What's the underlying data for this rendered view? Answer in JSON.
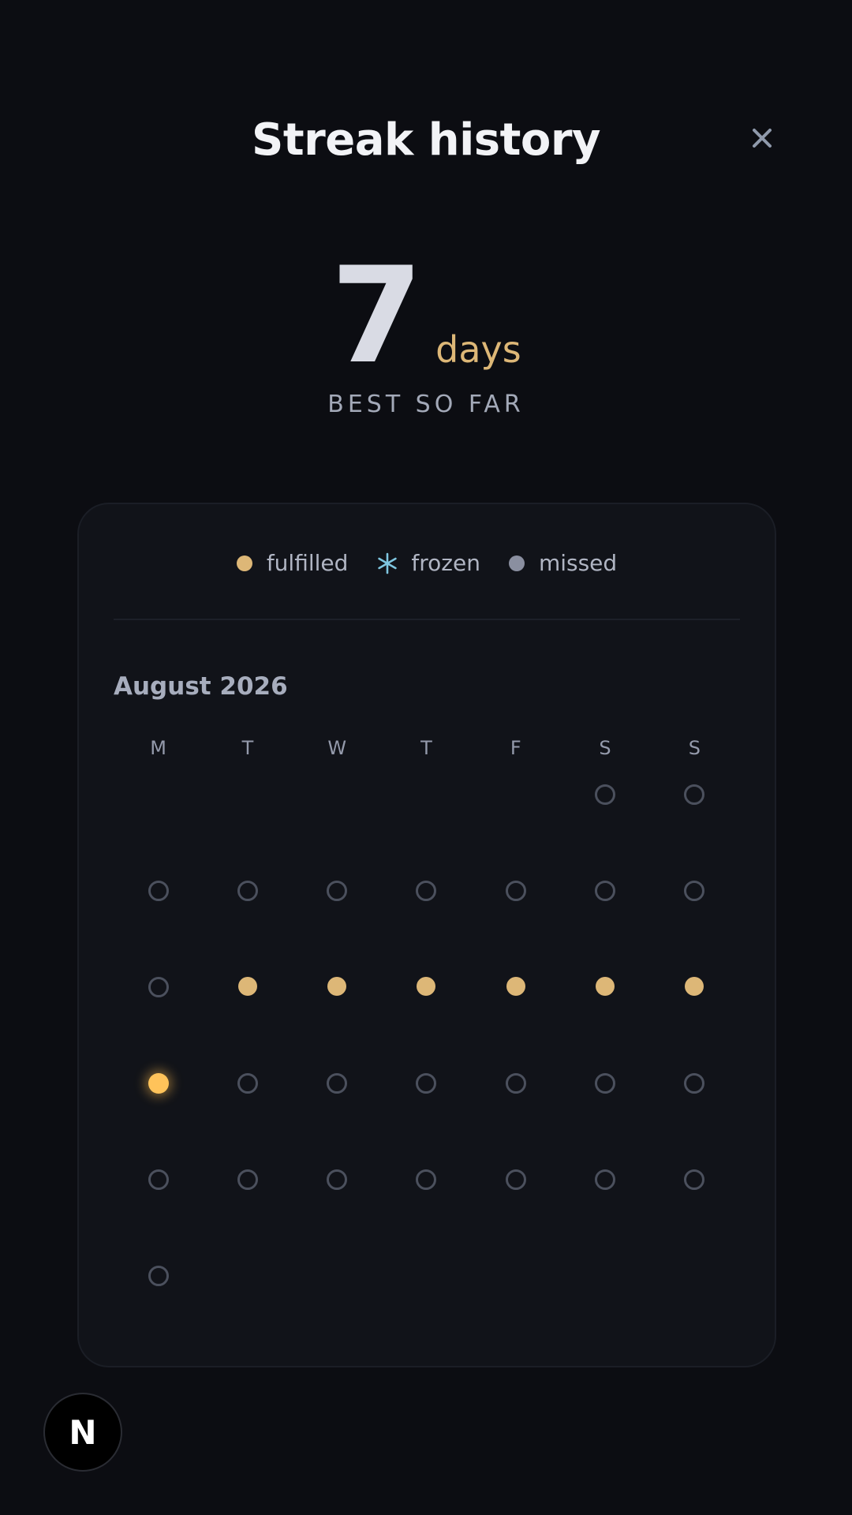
{
  "header": {
    "title": "Streak history",
    "close_icon": "close-icon"
  },
  "stat": {
    "value": "7",
    "unit": "days",
    "caption": "BEST SO FAR"
  },
  "legend": {
    "fulfilled": "fulfilled",
    "frozen": "frozen",
    "missed": "missed"
  },
  "colors": {
    "accent": "#ddb777",
    "today": "#ffc35a",
    "frozen": "#7fc6e0",
    "missed_dot": "#8a8fa0",
    "background": "#0c0d12",
    "card": "#111319"
  },
  "calendar": {
    "month": "August 2026",
    "weekdays": [
      "M",
      "T",
      "W",
      "T",
      "F",
      "S",
      "S"
    ],
    "weeks": [
      [
        "",
        "",
        "",
        "",
        "",
        "missed",
        "missed"
      ],
      [
        "missed",
        "missed",
        "missed",
        "missed",
        "missed",
        "missed",
        "missed"
      ],
      [
        "missed",
        "fulfilled",
        "fulfilled",
        "fulfilled",
        "fulfilled",
        "fulfilled",
        "fulfilled"
      ],
      [
        "today",
        "missed",
        "missed",
        "missed",
        "missed",
        "missed",
        "missed"
      ],
      [
        "missed",
        "missed",
        "missed",
        "missed",
        "missed",
        "missed",
        "missed"
      ],
      [
        "missed",
        "",
        "",
        "",
        "",
        "",
        ""
      ]
    ]
  },
  "badge": {
    "label": "N"
  }
}
